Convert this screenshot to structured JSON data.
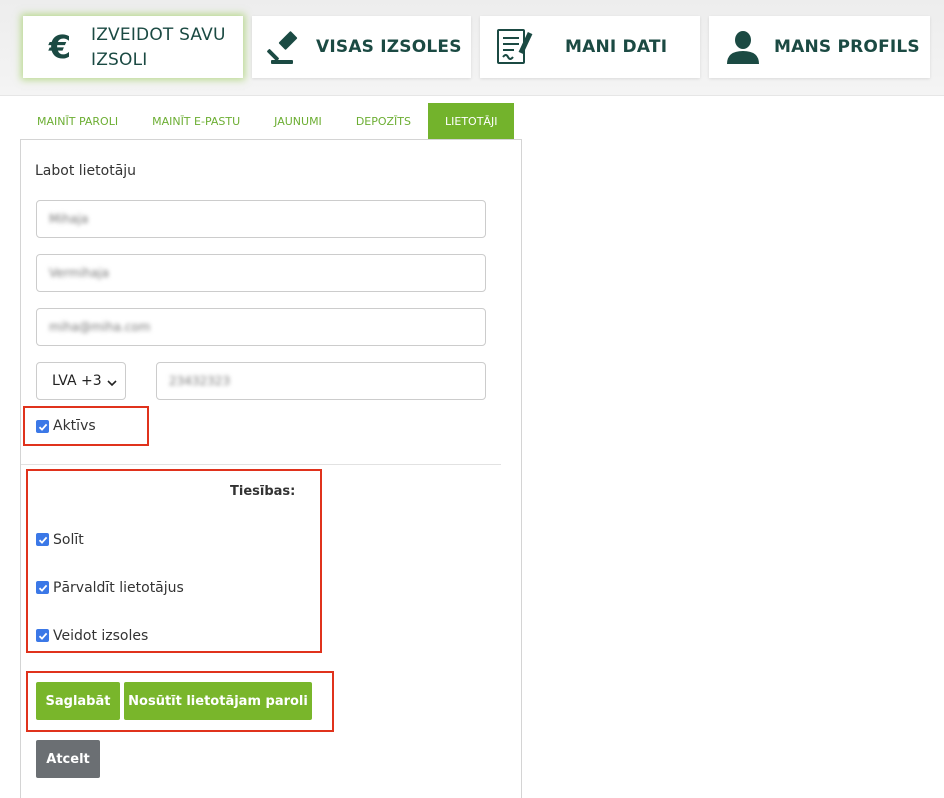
{
  "nav": {
    "create_auction": "IZVEIDOT SAVU IZSOLI",
    "all_auctions": "VISAS IZSOLES",
    "my_data": "MANI DATI",
    "my_profile": "MANS PROFILS",
    "euro_symbol": "€"
  },
  "tabs": [
    {
      "label": "MAINĪT PAROLI"
    },
    {
      "label": "MAINĪT E-PASTU"
    },
    {
      "label": "JAUNUMI"
    },
    {
      "label": "DEPOZĪTS"
    },
    {
      "label": "LIETOTĀJI",
      "active": true
    }
  ],
  "form": {
    "title": "Labot lietotāju",
    "first_name": "Mihaja",
    "last_name": "Vermihaja",
    "email": "miha@miha.com",
    "country_code": "LVA +3",
    "phone": "23432323",
    "active_label": "Aktīvs",
    "active_checked": true
  },
  "permissions": {
    "heading": "Tiesības:",
    "items": [
      {
        "label": "Solīt",
        "checked": true
      },
      {
        "label": "Pārvaldīt lietotājus",
        "checked": true
      },
      {
        "label": "Veidot izsoles",
        "checked": true
      }
    ]
  },
  "buttons": {
    "save": "Saglabāt",
    "send_password": "Nosūtīt lietotājam paroli",
    "cancel": "Atcelt"
  },
  "colors": {
    "accent_green": "#79b62b",
    "nav_text": "#1b4a43",
    "highlight_red": "#e0321c",
    "checkbox_blue": "#3b78e7"
  },
  "icons": {
    "create_auction": "euro-icon",
    "all_auctions": "gavel-icon",
    "my_data": "document-pen-icon",
    "my_profile": "user-icon"
  }
}
